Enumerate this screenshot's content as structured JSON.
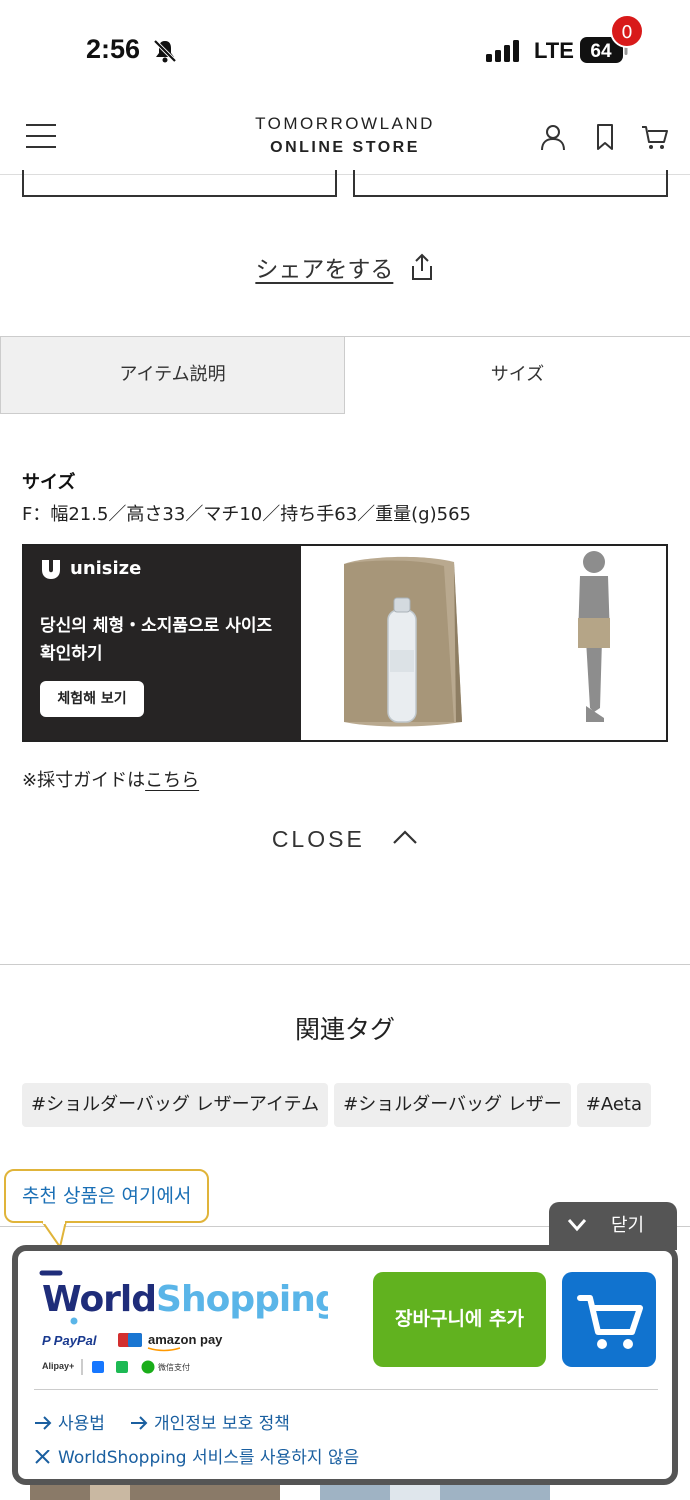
{
  "status_bar": {
    "time": "2:56",
    "network": "LTE",
    "battery": "64"
  },
  "header": {
    "logo_line1": "TOMORROWLAND",
    "logo_line2": "ONLINE STORE"
  },
  "share": {
    "label": "シェアをする"
  },
  "tabs": [
    {
      "label": "アイテム説明",
      "active": false
    },
    {
      "label": "サイズ",
      "active": true
    }
  ],
  "size": {
    "title": "サイズ",
    "spec": "F：幅21.5／高さ33／マチ10／持ち手63／重量(g)565"
  },
  "unisize": {
    "brand": "unisize",
    "text": "당신의 체형・소지품으로 사이즈 확인하기",
    "button": "체험해 보기"
  },
  "guide": {
    "prefix": "※採寸ガイドは",
    "link": "こちら"
  },
  "close_label": "CLOSE",
  "related": {
    "title": "関連タグ",
    "tags": [
      "#ショルダーバッグ レザーアイテム",
      "#ショルダーバッグ レザー",
      "#Aeta"
    ]
  },
  "worldshopping": {
    "bubble": "추천 상품은 여기에서",
    "close": "닫기",
    "logo_text": "WorldShopping",
    "add_to_cart": "장바구니에 추가",
    "cart_count": "0",
    "links": [
      "사용법",
      "개인정보 보호 정책"
    ],
    "opt_out": "WorldShopping 서비스를 사용하지 않음",
    "payment_labels": [
      "PayPal",
      "amazon pay",
      "Alipay+",
      "微信支付"
    ]
  },
  "colors": {
    "ws_green": "#61b21f",
    "ws_blue": "#1173cf",
    "ws_badge": "#d81a1a",
    "bubble_border": "#e0b43a"
  }
}
